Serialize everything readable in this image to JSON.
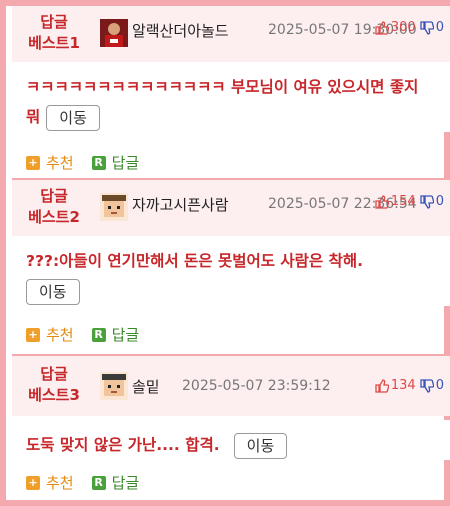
{
  "replies": [
    {
      "badge_line1": "답글",
      "badge_line2": "베스트1",
      "nickname": "알랙산더아놀드",
      "date": "2025-05-07 19:30:00",
      "up_count": "300",
      "down_count": "0",
      "text": "ㅋㅋㅋㅋㅋㅋㅋㅋㅋㅋㅋㅋㅋㅋ 부모님이 여유 있으시면 좋지 뭐",
      "move_label": "이동",
      "recommend_label": "추천",
      "reply_label": "답글",
      "avatar_icon": "red-jersey-avatar-icon"
    },
    {
      "badge_line1": "답글",
      "badge_line2": "베스트2",
      "nickname": "자까고시픈사람",
      "date": "2025-05-07 22:36:54",
      "up_count": "154",
      "down_count": "0",
      "text": "???:아들이 연기만해서 돈은 못벌어도 사람은 착해.",
      "move_label": "이동",
      "recommend_label": "추천",
      "reply_label": "답글",
      "avatar_icon": "pixel-face-avatar-icon"
    },
    {
      "badge_line1": "답글",
      "badge_line2": "베스트3",
      "nickname": "솔밑",
      "date": "2025-05-07 23:59:12",
      "up_count": "134",
      "down_count": "0",
      "text": "도둑 맞지 않은 가난.... 합격.",
      "move_label": "이동",
      "recommend_label": "추천",
      "reply_label": "답글",
      "avatar_icon": "pixel-face-avatar-icon"
    }
  ],
  "colors": {
    "border": "#f3a9ae",
    "header_bg": "#fdeff0",
    "accent_red": "#c7272b",
    "up_red": "#e04848",
    "down_blue": "#3553b8",
    "recommend_orange": "#e58a10",
    "reply_green": "#3a8a2a"
  }
}
